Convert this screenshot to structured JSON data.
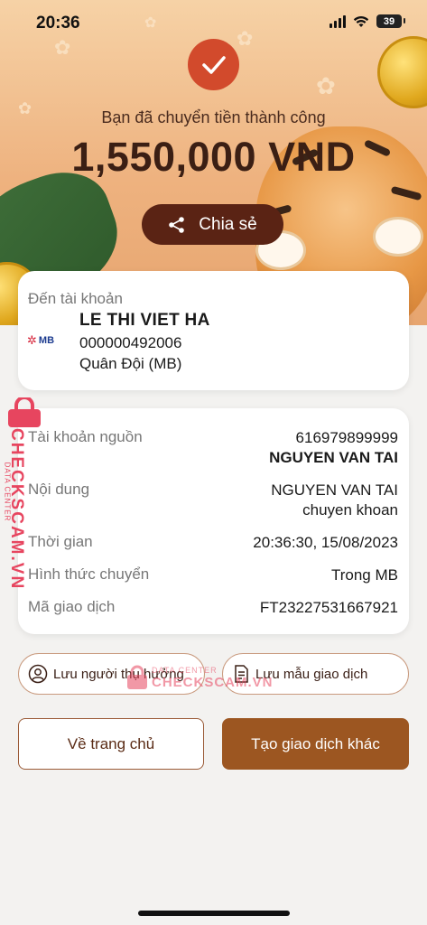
{
  "status_bar": {
    "time": "20:36",
    "battery": "39"
  },
  "success": {
    "message": "Bạn đã chuyển tiền thành công",
    "amount": "1,550,000 VND"
  },
  "share_button": {
    "label": "Chia sẻ"
  },
  "destination": {
    "label": "Đến tài khoản",
    "bank_logo_text": "MB",
    "name": "LE THI VIET HA",
    "account_number": "000000492006",
    "bank": "Quân Đội (MB)"
  },
  "details": {
    "source": {
      "label": "Tài khoản nguồn",
      "account": "616979899999",
      "name": "NGUYEN VAN TAI"
    },
    "content": {
      "label": "Nội dung",
      "line1": "NGUYEN VAN TAI",
      "line2": "chuyen khoan"
    },
    "time": {
      "label": "Thời gian",
      "value": "20:36:30, 15/08/2023"
    },
    "method": {
      "label": "Hình thức chuyển",
      "value": "Trong MB"
    },
    "transaction_id": {
      "label": "Mã giao dịch",
      "value": "FT23227531667921"
    }
  },
  "actions": {
    "save_beneficiary": "Lưu người thụ hưởng",
    "save_template": "Lưu mẫu giao dịch",
    "home": "Về trang chủ",
    "new_transaction": "Tạo giao dịch khác"
  },
  "watermark": {
    "brand": "CHECKSCAM.VN",
    "sub": "DATA CENTER"
  },
  "icons": [
    "signal-icon",
    "wifi-icon",
    "battery-icon",
    "checkmark-icon",
    "share-icon",
    "mb-bank-logo",
    "user-circle-icon",
    "document-icon",
    "lock-icon"
  ],
  "colors": {
    "accent": "#9c5621",
    "check": "#d24a2c",
    "share_bg": "#5a2314",
    "watermark": "#e7455f"
  }
}
